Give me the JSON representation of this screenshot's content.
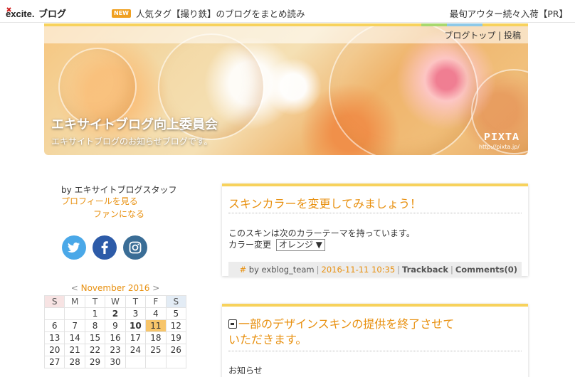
{
  "topbar": {
    "logo_text": "excite.ブログ",
    "new_badge": "NEW",
    "news_text": "人気タグ【撮り鉄】のブログをまとめ読み",
    "pr_text": "最旬アウター続々入荷【PR】"
  },
  "header": {
    "links": "ブログトップ | 投稿",
    "title": "エキサイトブログ向上委員会",
    "subtitle": "エキサイトブログのお知らせブログです。",
    "pixta_logo": "PIXTA",
    "pixta_url": "http://pixta.jp/",
    "stripe_colors": [
      "#f7d25c",
      "#f7d25c",
      "#f7d25c",
      "#f7d25c",
      "#a8d86e",
      "#8ec9e8",
      "#f7d25c"
    ]
  },
  "sidebar": {
    "byline": "by エキサイトブログスタッフ",
    "profile_link": "プロフィールを見る",
    "fan_link": "ファンになる",
    "social": [
      {
        "name": "twitter-icon",
        "glyph": "t"
      },
      {
        "name": "facebook-icon",
        "glyph": "f"
      },
      {
        "name": "instagram-icon",
        "glyph": "◎"
      }
    ],
    "calendar": {
      "prev": "<",
      "month": "November 2016",
      "next": ">",
      "dow": [
        "S",
        "M",
        "T",
        "W",
        "T",
        "F",
        "S"
      ],
      "weeks": [
        [
          "",
          "",
          "1",
          "2",
          "3",
          "4",
          "5"
        ],
        [
          "6",
          "7",
          "8",
          "9",
          "10",
          "11",
          "12"
        ],
        [
          "13",
          "14",
          "15",
          "16",
          "17",
          "18",
          "19"
        ],
        [
          "20",
          "21",
          "22",
          "23",
          "24",
          "25",
          "26"
        ],
        [
          "27",
          "28",
          "29",
          "30",
          "",
          "",
          ""
        ]
      ],
      "bold_days": [
        "2",
        "10"
      ],
      "today": "11"
    }
  },
  "posts": [
    {
      "title": "スキンカラーを変更してみましょう！",
      "body": "このスキンは次のカラーテーマを持っています。",
      "color_label": "カラー変更",
      "color_select": "オレンジ ▼",
      "footer": {
        "hash": "#",
        "by": "by exblog_team",
        "date": "2016-11-11 10:35",
        "trackback": "Trackback",
        "comments": "Comments(0)"
      }
    },
    {
      "title": "一部のデザインスキンの提供を終了させていただきます。",
      "body": "お知らせ"
    }
  ]
}
